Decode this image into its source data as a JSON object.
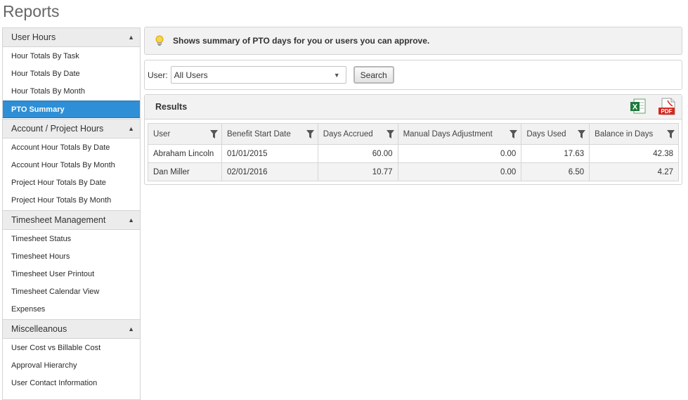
{
  "page": {
    "title": "Reports"
  },
  "sidebar": {
    "sections": [
      {
        "title": "User Hours",
        "items": [
          "Hour Totals By Task",
          "Hour Totals By Date",
          "Hour Totals By Month",
          "PTO Summary"
        ]
      },
      {
        "title": "Account / Project Hours",
        "items": [
          "Account Hour Totals By Date",
          "Account Hour Totals By Month",
          "Project Hour Totals By Date",
          "Project Hour Totals By Month"
        ]
      },
      {
        "title": "Timesheet Management",
        "items": [
          "Timesheet Status",
          "Timesheet Hours",
          "Timesheet User Printout",
          "Timesheet Calendar View",
          "Expenses"
        ]
      },
      {
        "title": "Miscelleanous",
        "items": [
          "User Cost vs Billable Cost",
          "Approval Hierarchy",
          "User Contact Information"
        ]
      }
    ],
    "active_item": "PTO Summary"
  },
  "info": {
    "message": "Shows summary of PTO days for you or users you can approve."
  },
  "filter": {
    "user_label": "User:",
    "user_value": "All Users",
    "search_label": "Search"
  },
  "results": {
    "title": "Results",
    "export_icons": [
      "excel-icon",
      "pdf-icon"
    ],
    "columns": [
      "User",
      "Benefit Start Date",
      "Days Accrued",
      "Manual Days Adjustment",
      "Days Used",
      "Balance in Days"
    ],
    "rows": [
      [
        "Abraham Lincoln",
        "01/01/2015",
        "60.00",
        "0.00",
        "17.63",
        "42.38"
      ],
      [
        "Dan Miller",
        "02/01/2016",
        "10.77",
        "0.00",
        "6.50",
        "4.27"
      ]
    ]
  },
  "colors": {
    "active_nav": "#2e8fd6",
    "excel": "#1f7a3d",
    "pdf": "#d42a22"
  }
}
